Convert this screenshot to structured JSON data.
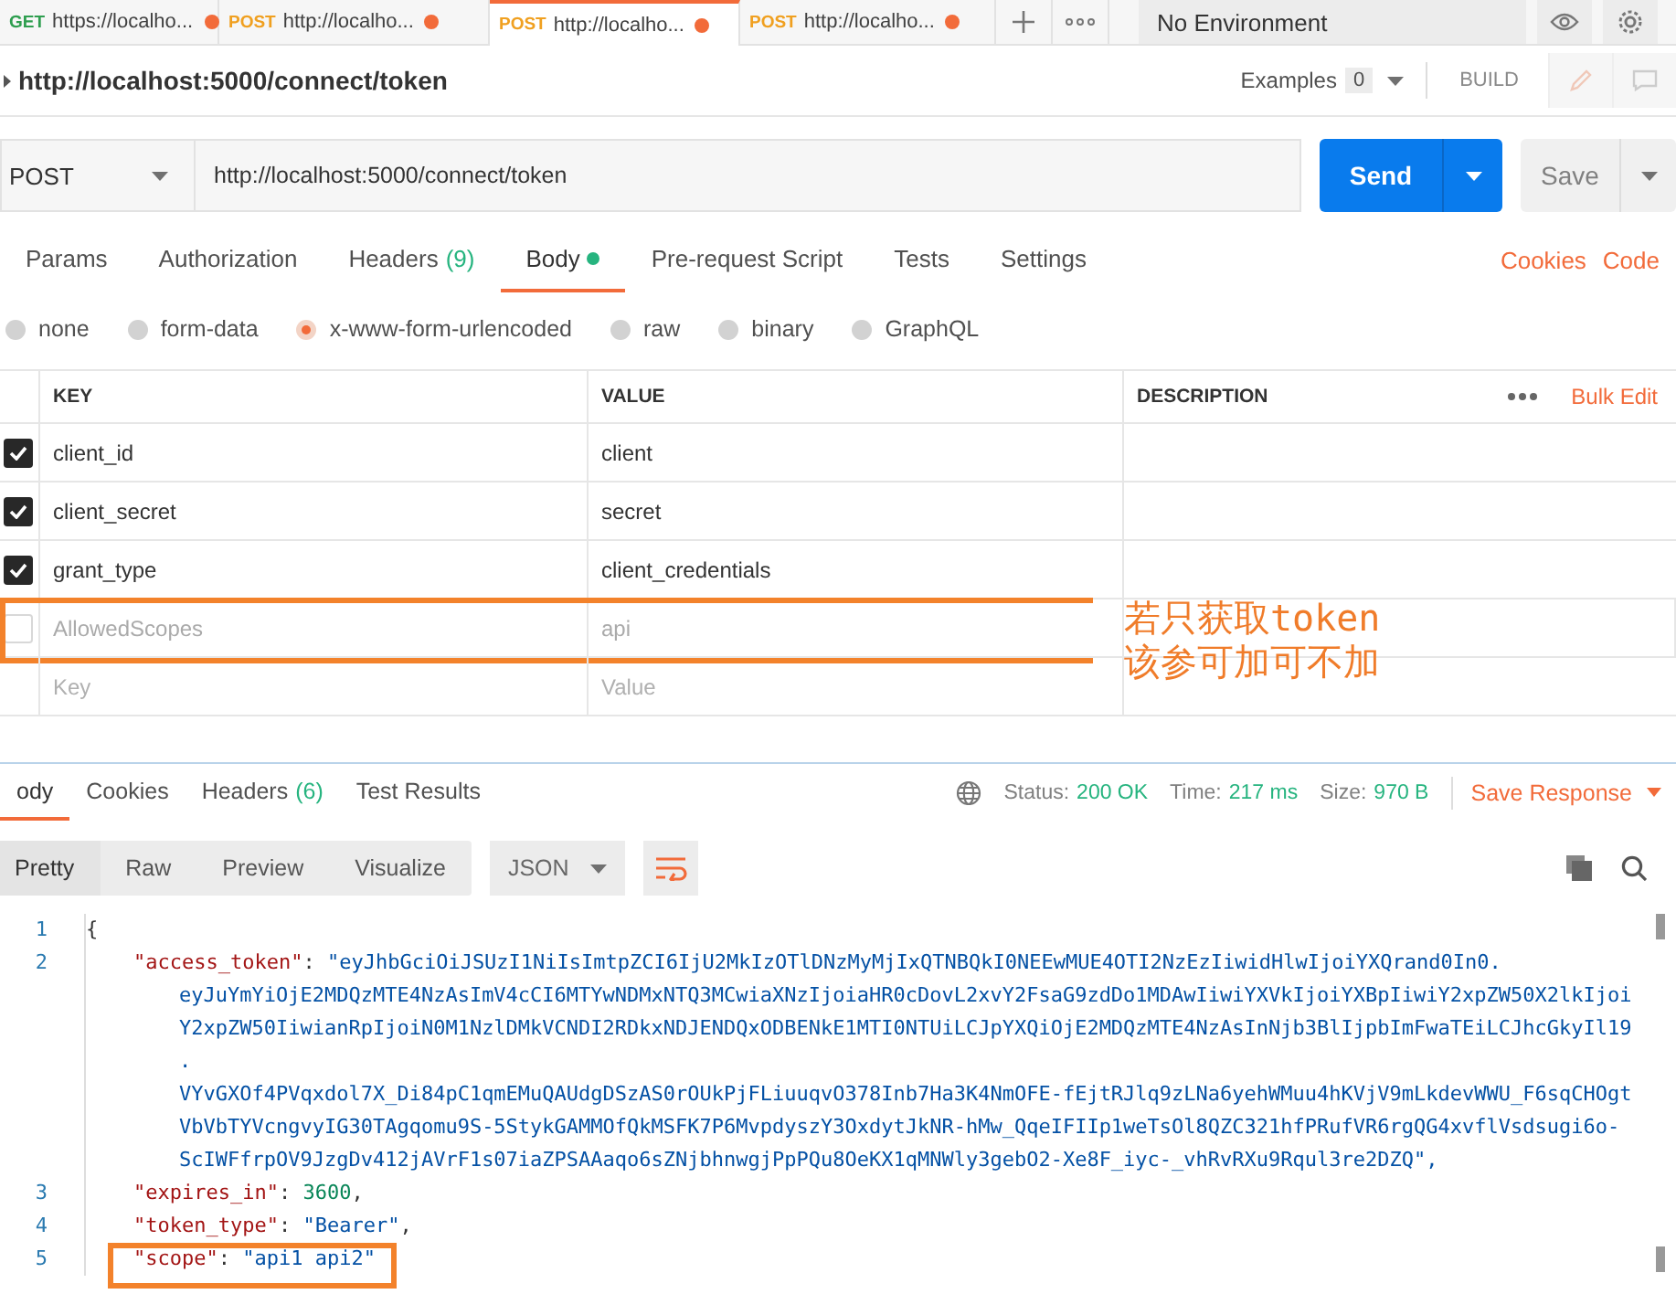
{
  "tabs": [
    {
      "method": "GET",
      "url": "https://localho...",
      "color": "#2e9e4f",
      "unsaved": true,
      "selected": false
    },
    {
      "method": "POST",
      "url": "http://localho...",
      "color": "#f0a020",
      "unsaved": true,
      "selected": false
    },
    {
      "method": "POST",
      "url": "http://localho...",
      "color": "#f0a020",
      "unsaved": true,
      "selected": true
    },
    {
      "method": "POST",
      "url": "http://localho...",
      "color": "#f0a020",
      "unsaved": true,
      "selected": false
    }
  ],
  "environment": {
    "value": "No Environment"
  },
  "request": {
    "title": "http://localhost:5000/connect/token",
    "examples_label": "Examples",
    "examples_count": "0",
    "build": "BUILD"
  },
  "url_bar": {
    "method": "POST",
    "url": "http://localhost:5000/connect/token",
    "send": "Send",
    "save": "Save"
  },
  "request_tabs": [
    {
      "label": "Params",
      "dot": false,
      "selected": false
    },
    {
      "label": "Authorization",
      "dot": false,
      "selected": false
    },
    {
      "label": "Headers",
      "count": "(9)",
      "dot": false,
      "selected": false
    },
    {
      "label": "Body",
      "dot": true,
      "selected": true
    },
    {
      "label": "Pre-request Script",
      "dot": false,
      "selected": false
    },
    {
      "label": "Tests",
      "dot": false,
      "selected": false
    },
    {
      "label": "Settings",
      "dot": false,
      "selected": false
    }
  ],
  "request_links": [
    "Cookies",
    "Code"
  ],
  "body_types": [
    {
      "label": "none",
      "selected": false
    },
    {
      "label": "form-data",
      "selected": false
    },
    {
      "label": "x-www-form-urlencoded",
      "selected": true
    },
    {
      "label": "raw",
      "selected": false
    },
    {
      "label": "binary",
      "selected": false
    },
    {
      "label": "GraphQL",
      "selected": false
    }
  ],
  "params": {
    "columns": [
      "KEY",
      "VALUE",
      "DESCRIPTION"
    ],
    "bulk_edit": "Bulk Edit",
    "rows": [
      {
        "key": "client_id",
        "value": "client",
        "checked": true,
        "highlighted": false
      },
      {
        "key": "client_secret",
        "value": "secret",
        "checked": true,
        "highlighted": false
      },
      {
        "key": "grant_type",
        "value": "client_credentials",
        "checked": true,
        "highlighted": false
      },
      {
        "key": "AllowedScopes",
        "value": "api",
        "checked": false,
        "highlighted": true
      }
    ],
    "new_row": {
      "key_placeholder": "Key",
      "value_placeholder": "Value"
    }
  },
  "note": [
    "若只获取token",
    "该参可加可不加"
  ],
  "response_tabs": [
    {
      "label": "ody",
      "selected": true
    },
    {
      "label": "Cookies",
      "selected": false
    },
    {
      "label": "Headers",
      "count": "(6)",
      "selected": false
    },
    {
      "label": "Test Results",
      "selected": false
    }
  ],
  "response_meta": [
    {
      "label": "Status:",
      "value": "200 OK"
    },
    {
      "label": "Time:",
      "value": "217 ms"
    },
    {
      "label": "Size:",
      "value": "970 B"
    }
  ],
  "save_response": "Save Response",
  "view_modes": [
    {
      "label": "Pretty",
      "selected": true
    },
    {
      "label": "Raw",
      "selected": false
    },
    {
      "label": "Preview",
      "selected": false
    },
    {
      "label": "Visualize",
      "selected": false
    }
  ],
  "format": "JSON",
  "code_lines": [
    {
      "number": "1",
      "highlighted": false,
      "parts": [
        {
          "kind": "punct",
          "text": "{"
        }
      ]
    },
    {
      "number": "2",
      "highlighted": false,
      "parts": [
        {
          "kind": "key",
          "text": "\"access_token\""
        },
        {
          "kind": "punct",
          "text": ": "
        },
        {
          "kind": "string",
          "text": "\"eyJhbGciOiJSUzI1NiIsImtpZCI6IjU2MkIzOTlDNzMyMjIxQTNBQkI0NEEwMUE4OTI2NzEzIiwidHlwIjoiYXQrand0In0."
        }
      ],
      "wrapped": [
        "eyJuYmYiOjE2MDQzMTE4NzAsImV4cCI6MTYwNDMxNTQ3MCwiaXNzIjoiaHR0cDovL2xvY2FsaG9zdDo1MDAwIiwiYXVkIjoiYXBpIiwiY2xpZW50X2lkIjoi",
        "Y2xpZW50IiwianRpIjoiN0M1NzlDMkVCNDI2RDkxNDJENDQxODBENkE1MTI0NTUiLCJpYXQiOjE2MDQzMTE4NzAsInNjb3BlIjpbImFwaTEiLCJhcGkyIl19",
        ".",
        "VYvGXOf4PVqxdol7X_Di84pC1qmEMuQAUdgDSzAS0rOUkPjFLiuuqvO378Inb7Ha3K4NmOFE-fEjtRJlq9zLNa6yehWMuu4hKVjV9mLkdevWWU_F6sqCHOgt",
        "VbVbTYVcngvyIG30TAgqomu9S-5StykGAMMOfQkMSFK7P6MvpdyszY3OxdytJkNR-hMw_QqeIFIIp1weTsOl8QZC321hfPRufVR6rgQG4xvflVsdsugi6o-",
        "ScIWFfrpOV9JzgDv412jAVrF1s07iaZPSAAaqo6sZNjbhnwgjPpPQu8OeKX1qMNWly3gebO2-Xe8F_iyc-_vhRvRXu9Rqul3re2DZQ\","
      ]
    },
    {
      "number": "3",
      "highlighted": false,
      "parts": [
        {
          "kind": "key",
          "text": "\"expires_in\""
        },
        {
          "kind": "punct",
          "text": ": "
        },
        {
          "kind": "number",
          "text": "3600"
        },
        {
          "kind": "punct",
          "text": ","
        }
      ]
    },
    {
      "number": "4",
      "highlighted": false,
      "parts": [
        {
          "kind": "key",
          "text": "\"token_type\""
        },
        {
          "kind": "punct",
          "text": ": "
        },
        {
          "kind": "string",
          "text": "\"Bearer\""
        },
        {
          "kind": "punct",
          "text": ","
        }
      ]
    },
    {
      "number": "5",
      "highlighted": true,
      "parts": [
        {
          "kind": "key",
          "text": "\"scope\""
        },
        {
          "kind": "punct",
          "text": ": "
        },
        {
          "kind": "string",
          "text": "\"api1 api2\""
        }
      ]
    }
  ]
}
